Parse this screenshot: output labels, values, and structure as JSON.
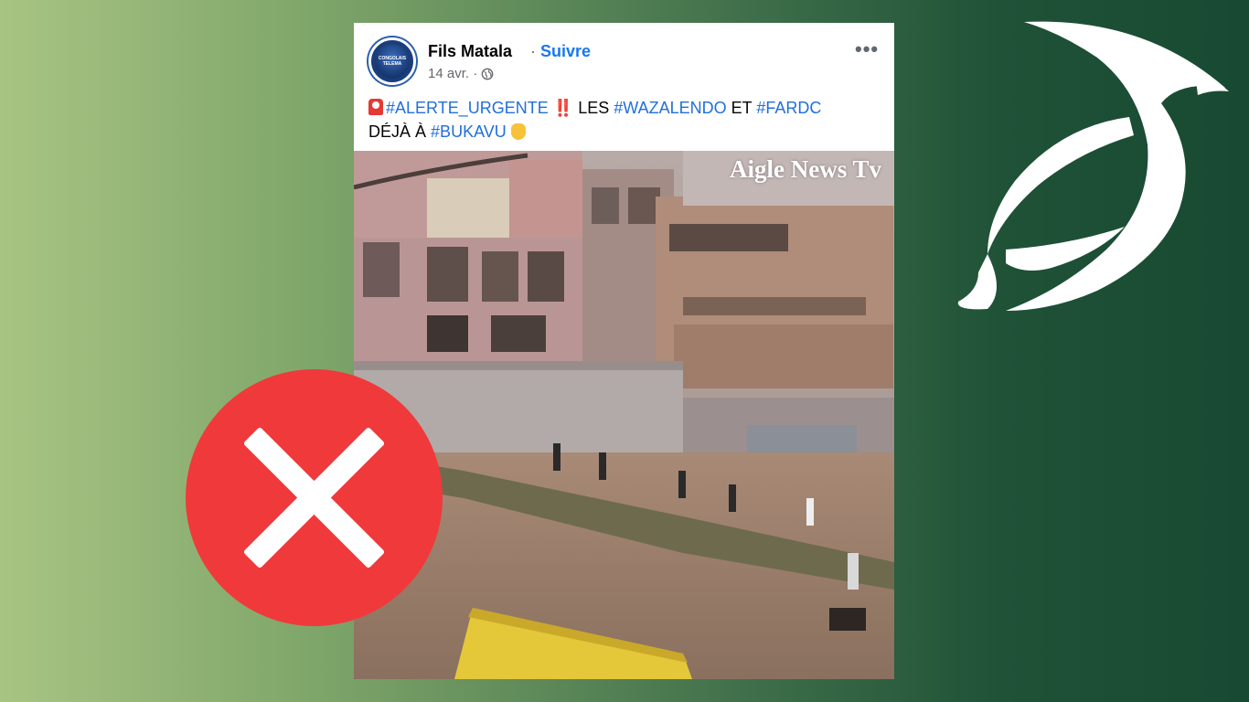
{
  "post": {
    "author": "Fils Matala",
    "separator": "·",
    "follow_label": "Suivre",
    "date": "14 avr. ·",
    "audience_icon": "globe-icon",
    "more_icon": "more-options-icon",
    "more_label": "•••",
    "avatar_text": "CONGOLAIS\nTELEMA",
    "caption": {
      "tag1": "#ALERTE_URGENTE",
      "bang": "‼️",
      "text1": "LES",
      "tag2": "#WAZALENDO",
      "text2": "ET",
      "tag3": "#FARDC",
      "text3": "DÉJÀ À",
      "tag4": "#BUKAVU"
    },
    "video": {
      "watermark": "Aigle News Tv"
    }
  },
  "overlay": {
    "verdict_icon": "false-cross-icon",
    "badge_color": "#f0393b"
  },
  "brand": {
    "logo_icon": "bird-logo-icon"
  }
}
